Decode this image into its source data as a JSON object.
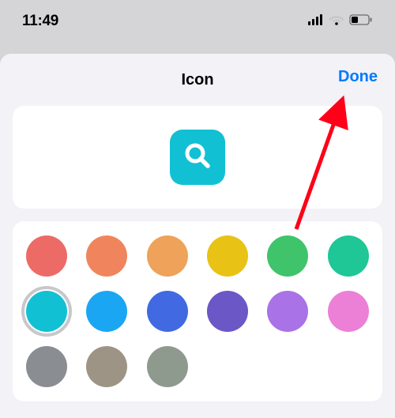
{
  "status": {
    "time": "11:49"
  },
  "sheet": {
    "title": "Icon",
    "done_label": "Done"
  },
  "preview": {
    "icon": "search-icon",
    "bg_color": "#12c0d4"
  },
  "colors": [
    {
      "hex": "#ec6b66",
      "selected": false
    },
    {
      "hex": "#f0855d",
      "selected": false
    },
    {
      "hex": "#eea25a",
      "selected": false
    },
    {
      "hex": "#e9c216",
      "selected": false
    },
    {
      "hex": "#3fc46b",
      "selected": false
    },
    {
      "hex": "#1fc696",
      "selected": false
    },
    {
      "hex": "#12c0d4",
      "selected": true
    },
    {
      "hex": "#1ba6f4",
      "selected": false
    },
    {
      "hex": "#4169e1",
      "selected": false
    },
    {
      "hex": "#6b57c6",
      "selected": false
    },
    {
      "hex": "#a972e6",
      "selected": false
    },
    {
      "hex": "#ec80d6",
      "selected": false
    },
    {
      "hex": "#8a8d91",
      "selected": false
    },
    {
      "hex": "#9d9486",
      "selected": false
    },
    {
      "hex": "#8f9a8f",
      "selected": false
    }
  ],
  "annotation": {
    "arrow_color": "#ff0018"
  }
}
